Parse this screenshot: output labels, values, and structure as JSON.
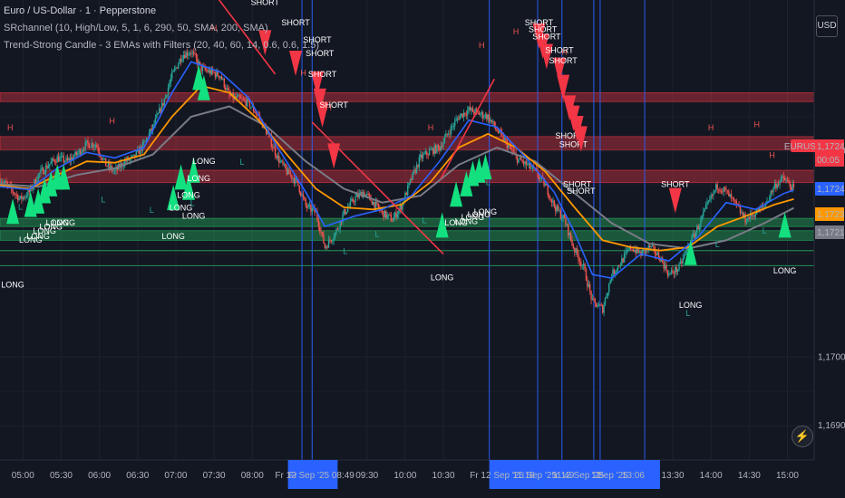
{
  "legend": {
    "title": "Euro / US-Dollar · 1 · Pepperstone",
    "indicator1": "SRchannel (10, High/Low, 5, 1, 6, 290, 50, SMA, 200, SMA)",
    "indicator2": "Trend-Strong Candle - 3 EMAs with Filters (20, 40, 60, 14, 0.6, 0.6, 1.5)"
  },
  "currency_badge": "USD",
  "bolt_icon": "lightning-icon",
  "colors": {
    "bg": "#131722",
    "up": "#26a69a",
    "down": "#ef5350",
    "long": "#13e07f",
    "short": "#f23645",
    "ema_fast": "#2962ff",
    "ema_mid": "#ff9800",
    "ema_slow": "#787b86",
    "vline": "#2962ff"
  },
  "chart_data": {
    "type": "candlestick",
    "symbol": "EURUSD",
    "x_ticks": [
      "05:00",
      "05:30",
      "06:00",
      "06:30",
      "07:00",
      "07:30",
      "08:00",
      "09:30",
      "10:00",
      "10:30",
      "13:30",
      "14:00",
      "14:30",
      "15:00"
    ],
    "x_range": [
      "04:42",
      "15:21"
    ],
    "y_ticks": [
      "1,17300",
      "1,17000",
      "1,16900"
    ],
    "y_tick_values": [
      1.173,
      1.17,
      1.169
    ],
    "ylim": [
      1.1685,
      1.1752
    ],
    "price_labels": [
      {
        "label": "EURUSD",
        "value": 1.17244,
        "color": "#f23645"
      },
      {
        "label": "1,17244",
        "value": 1.17244,
        "color": "#f23645"
      },
      {
        "label": "00:05",
        "value": 1.17244,
        "color": "#f23645",
        "sub": true
      },
      {
        "label": "1,17243",
        "value": 1.17243,
        "color": "#2962ff"
      },
      {
        "label": "1,17230",
        "value": 1.1723,
        "color": "#ff9800"
      },
      {
        "label": "1,17217",
        "value": 1.17217,
        "color": "#787b86"
      }
    ],
    "resistance_zones": [
      [
        1.17372,
        1.17385
      ],
      [
        1.17302,
        1.17321
      ],
      [
        1.17254,
        1.17272
      ]
    ],
    "support_zones": [
      [
        1.1719,
        1.17202
      ],
      [
        1.1717,
        1.17184
      ]
    ],
    "support_lines": [
      1.17155,
      1.17133
    ],
    "vertical_markers": [
      {
        "time": "08:39",
        "label": "Fr 12 Sep '25  08:49"
      },
      {
        "time": "08:47",
        "label": ""
      },
      {
        "time": "11:06",
        "label": "Fr 12 Sep '25  11:18"
      },
      {
        "time": "11:44",
        "label": "Sep '25  11:49"
      },
      {
        "time": "12:03",
        "label": "r 12 Sep '25  12"
      },
      {
        "time": "12:28",
        "label": "Sep '25  13:06"
      },
      {
        "time": "12:33",
        "label": ""
      },
      {
        "time": "13:08",
        "label": ""
      }
    ],
    "bottom_time_labels": [
      {
        "text": "Fr",
        "x_time": "08:32"
      },
      {
        "text": "Fr 12 Sep '25  08:49",
        "x_time": "08:49"
      },
      {
        "text": "Fr 12 Sep '25",
        "x_time": "11:12"
      },
      {
        "text": "11:18",
        "x_time": "11:33"
      },
      {
        "text": "Sep '25",
        "x_time": "11:47"
      },
      {
        "text": "11:49",
        "x_time": "12:04"
      },
      {
        "text": "r 12 Sep '25",
        "x_time": "12:17"
      },
      {
        "text": "12",
        "x_time": "12:30"
      },
      {
        "text": "Sep '25",
        "x_time": "12:43"
      },
      {
        "text": "13:06",
        "x_time": "12:59"
      }
    ],
    "series_close": [
      [
        "04:42",
        1.1726
      ],
      [
        "04:50",
        1.17245
      ],
      [
        "04:58",
        1.1723
      ],
      [
        "05:05",
        1.1724
      ],
      [
        "05:12",
        1.17265
      ],
      [
        "05:20",
        1.1728
      ],
      [
        "05:27",
        1.1729
      ],
      [
        "05:35",
        1.17285
      ],
      [
        "05:42",
        1.17295
      ],
      [
        "05:50",
        1.1731
      ],
      [
        "05:57",
        1.1731
      ],
      [
        "06:05",
        1.1728
      ],
      [
        "06:12",
        1.1727
      ],
      [
        "06:20",
        1.17285
      ],
      [
        "06:27",
        1.1729
      ],
      [
        "06:35",
        1.1731
      ],
      [
        "06:42",
        1.17335
      ],
      [
        "06:50",
        1.1737
      ],
      [
        "06:57",
        1.1741
      ],
      [
        "07:05",
        1.1744
      ],
      [
        "07:12",
        1.17445
      ],
      [
        "07:20",
        1.1742
      ],
      [
        "07:27",
        1.17415
      ],
      [
        "07:35",
        1.1741
      ],
      [
        "07:42",
        1.1738
      ],
      [
        "07:50",
        1.17375
      ],
      [
        "07:57",
        1.1737
      ],
      [
        "08:05",
        1.1735
      ],
      [
        "08:12",
        1.17325
      ],
      [
        "08:20",
        1.1729
      ],
      [
        "08:27",
        1.1727
      ],
      [
        "08:35",
        1.17255
      ],
      [
        "08:42",
        1.1722
      ],
      [
        "08:50",
        1.1721
      ],
      [
        "08:57",
        1.1716
      ],
      [
        "09:05",
        1.1718
      ],
      [
        "09:12",
        1.1721
      ],
      [
        "09:20",
        1.1723
      ],
      [
        "09:27",
        1.1724
      ],
      [
        "09:35",
        1.17225
      ],
      [
        "09:42",
        1.1721
      ],
      [
        "09:50",
        1.172
      ],
      [
        "09:57",
        1.1722
      ],
      [
        "10:05",
        1.1726
      ],
      [
        "10:12",
        1.1729
      ],
      [
        "10:20",
        1.173
      ],
      [
        "10:27",
        1.17305
      ],
      [
        "10:35",
        1.1733
      ],
      [
        "10:42",
        1.1735
      ],
      [
        "10:50",
        1.1736
      ],
      [
        "10:57",
        1.17355
      ],
      [
        "11:05",
        1.1735
      ],
      [
        "11:12",
        1.1733
      ],
      [
        "11:20",
        1.1731
      ],
      [
        "11:27",
        1.1729
      ],
      [
        "11:35",
        1.1728
      ],
      [
        "11:42",
        1.1727
      ],
      [
        "11:50",
        1.1725
      ],
      [
        "11:57",
        1.1722
      ],
      [
        "12:05",
        1.172
      ],
      [
        "12:12",
        1.1716
      ],
      [
        "12:20",
        1.1713
      ],
      [
        "12:27",
        1.1708
      ],
      [
        "12:35",
        1.1707
      ],
      [
        "12:42",
        1.1712
      ],
      [
        "12:50",
        1.1714
      ],
      [
        "12:57",
        1.1716
      ],
      [
        "13:05",
        1.1715
      ],
      [
        "13:12",
        1.1716
      ],
      [
        "13:20",
        1.17145
      ],
      [
        "13:27",
        1.1712
      ],
      [
        "13:35",
        1.1713
      ],
      [
        "13:42",
        1.1716
      ],
      [
        "13:50",
        1.1719
      ],
      [
        "13:57",
        1.1722
      ],
      [
        "14:05",
        1.1725
      ],
      [
        "14:12",
        1.1724
      ],
      [
        "14:20",
        1.1722
      ],
      [
        "14:27",
        1.172
      ],
      [
        "14:35",
        1.1721
      ],
      [
        "14:42",
        1.1722
      ],
      [
        "14:50",
        1.1725
      ],
      [
        "14:57",
        1.1726
      ],
      [
        "15:05",
        1.17244
      ]
    ],
    "ema_fast": [
      [
        "04:42",
        1.17248
      ],
      [
        "05:05",
        1.17244
      ],
      [
        "05:27",
        1.17275
      ],
      [
        "05:50",
        1.17298
      ],
      [
        "06:12",
        1.1729
      ],
      [
        "06:35",
        1.17305
      ],
      [
        "06:57",
        1.17385
      ],
      [
        "07:12",
        1.1743
      ],
      [
        "07:35",
        1.17415
      ],
      [
        "07:57",
        1.17378
      ],
      [
        "08:20",
        1.17305
      ],
      [
        "08:42",
        1.1724
      ],
      [
        "08:57",
        1.1719
      ],
      [
        "09:20",
        1.17205
      ],
      [
        "09:42",
        1.17215
      ],
      [
        "10:05",
        1.17235
      ],
      [
        "10:27",
        1.17285
      ],
      [
        "10:50",
        1.17345
      ],
      [
        "11:12",
        1.17335
      ],
      [
        "11:35",
        1.1729
      ],
      [
        "11:57",
        1.1724
      ],
      [
        "12:12",
        1.17185
      ],
      [
        "12:27",
        1.1712
      ],
      [
        "12:42",
        1.17115
      ],
      [
        "13:05",
        1.1715
      ],
      [
        "13:27",
        1.1714
      ],
      [
        "13:50",
        1.17175
      ],
      [
        "14:12",
        1.17225
      ],
      [
        "14:35",
        1.17215
      ],
      [
        "14:57",
        1.17238
      ],
      [
        "15:05",
        1.17243
      ]
    ],
    "ema_mid": [
      [
        "04:42",
        1.1725
      ],
      [
        "05:05",
        1.17245
      ],
      [
        "05:27",
        1.17265
      ],
      [
        "05:50",
        1.17285
      ],
      [
        "06:12",
        1.17283
      ],
      [
        "06:35",
        1.17295
      ],
      [
        "06:57",
        1.1735
      ],
      [
        "07:20",
        1.17395
      ],
      [
        "07:42",
        1.17385
      ],
      [
        "08:05",
        1.17345
      ],
      [
        "08:27",
        1.17295
      ],
      [
        "08:50",
        1.17245
      ],
      [
        "09:12",
        1.17218
      ],
      [
        "09:35",
        1.17215
      ],
      [
        "09:57",
        1.17222
      ],
      [
        "10:20",
        1.17255
      ],
      [
        "10:42",
        1.17305
      ],
      [
        "11:05",
        1.17325
      ],
      [
        "11:27",
        1.17305
      ],
      [
        "11:50",
        1.1727
      ],
      [
        "12:12",
        1.1722
      ],
      [
        "12:35",
        1.1717
      ],
      [
        "12:57",
        1.1716
      ],
      [
        "13:20",
        1.17155
      ],
      [
        "13:42",
        1.1716
      ],
      [
        "14:05",
        1.1719
      ],
      [
        "14:27",
        1.17205
      ],
      [
        "14:50",
        1.17222
      ],
      [
        "15:05",
        1.1723
      ]
    ],
    "ema_slow": [
      [
        "04:42",
        1.17252
      ],
      [
        "05:12",
        1.17248
      ],
      [
        "05:42",
        1.17265
      ],
      [
        "06:12",
        1.17275
      ],
      [
        "06:42",
        1.17295
      ],
      [
        "07:12",
        1.1735
      ],
      [
        "07:42",
        1.17365
      ],
      [
        "08:12",
        1.17335
      ],
      [
        "08:42",
        1.17285
      ],
      [
        "09:12",
        1.17245
      ],
      [
        "09:42",
        1.17225
      ],
      [
        "10:12",
        1.17235
      ],
      [
        "10:42",
        1.1728
      ],
      [
        "11:12",
        1.17305
      ],
      [
        "11:42",
        1.17285
      ],
      [
        "12:12",
        1.1724
      ],
      [
        "12:42",
        1.17195
      ],
      [
        "13:12",
        1.17165
      ],
      [
        "13:42",
        1.17158
      ],
      [
        "14:12",
        1.1717
      ],
      [
        "14:42",
        1.17195
      ],
      [
        "15:05",
        1.17217
      ]
    ],
    "trend_lines": [
      {
        "from": [
          "07:32",
          1.17525
        ],
        "to": [
          "08:18",
          1.17412
        ],
        "color": "#f23645"
      },
      {
        "from": [
          "08:47",
          1.17342
        ],
        "to": [
          "10:30",
          1.1715
        ],
        "color": "#f23645"
      },
      {
        "from": [
          "10:28",
          1.1726
        ],
        "to": [
          "11:10",
          1.17405
        ],
        "color": "#f23645"
      }
    ],
    "long_signals": [
      {
        "time": "04:52",
        "value": 1.17215,
        "label": "LONG",
        "label_value": 1.1712
      },
      {
        "time": "05:06",
        "value": 1.17225,
        "label": "LONG",
        "label_value": 1.17185
      },
      {
        "time": "05:12",
        "value": 1.1723,
        "label": "LONG",
        "label_value": 1.1719
      },
      {
        "time": "05:17",
        "value": 1.17245,
        "label": "LONG",
        "label_value": 1.17198
      },
      {
        "time": "05:22",
        "value": 1.17255,
        "label": "LONG",
        "label_value": 1.17204
      },
      {
        "time": "05:27",
        "value": 1.17265,
        "label": "LONG",
        "label_value": 1.1721
      },
      {
        "time": "05:32",
        "value": 1.17265,
        "label": "LONG",
        "label_value": 1.1721
      },
      {
        "time": "06:58",
        "value": 1.17235,
        "label": "LONG",
        "label_value": 1.1719
      },
      {
        "time": "07:04",
        "value": 1.17265,
        "label": "LONG",
        "label_value": 1.17232
      },
      {
        "time": "07:10",
        "value": 1.1725,
        "label": "LONG",
        "label_value": 1.1725
      },
      {
        "time": "07:14",
        "value": 1.17275,
        "label": "LONG",
        "label_value": 1.1722
      },
      {
        "time": "07:18",
        "value": 1.1741,
        "label": "LONG",
        "label_value": 1.17275
      },
      {
        "time": "07:22",
        "value": 1.17395,
        "label": "LONG",
        "label_value": 1.173
      },
      {
        "time": "10:29",
        "value": 1.17195,
        "label": "LONG",
        "label_value": 1.1713
      },
      {
        "time": "10:40",
        "value": 1.1724,
        "label": "LONG",
        "label_value": 1.1721
      },
      {
        "time": "10:48",
        "value": 1.17255,
        "label": "LONG",
        "label_value": 1.17212
      },
      {
        "time": "10:53",
        "value": 1.1727,
        "label": "LONG",
        "label_value": 1.17218
      },
      {
        "time": "10:58",
        "value": 1.17275,
        "label": "LONG",
        "label_value": 1.17222
      },
      {
        "time": "11:03",
        "value": 1.1728,
        "label": "LONG",
        "label_value": 1.17226
      },
      {
        "time": "13:44",
        "value": 1.17155,
        "label": "LONG",
        "label_value": 1.1709
      },
      {
        "time": "14:58",
        "value": 1.17195,
        "label": "LONG",
        "label_value": 1.1714
      }
    ],
    "short_signals": [
      {
        "time": "08:10",
        "value": 1.17455,
        "label": "SHORT",
        "label_value": 1.17505
      },
      {
        "time": "08:34",
        "value": 1.17425,
        "label": "SHORT",
        "label_value": 1.17475
      },
      {
        "time": "08:51",
        "value": 1.17395,
        "label": "SHORT",
        "label_value": 1.1745
      },
      {
        "time": "08:53",
        "value": 1.1737,
        "label": "SHORT",
        "label_value": 1.1743
      },
      {
        "time": "08:55",
        "value": 1.1735,
        "label": "SHORT",
        "label_value": 1.174
      },
      {
        "time": "09:04",
        "value": 1.1729,
        "label": "SHORT",
        "label_value": 1.17355
      },
      {
        "time": "11:45",
        "value": 1.17465,
        "label": "SHORT",
        "label_value": 1.17475
      },
      {
        "time": "11:48",
        "value": 1.1745,
        "label": "SHORT",
        "label_value": 1.17465
      },
      {
        "time": "11:51",
        "value": 1.17435,
        "label": "SHORT",
        "label_value": 1.17455
      },
      {
        "time": "12:01",
        "value": 1.17415,
        "label": "SHORT",
        "label_value": 1.17435
      },
      {
        "time": "12:04",
        "value": 1.1739,
        "label": "SHORT",
        "label_value": 1.1742
      },
      {
        "time": "12:09",
        "value": 1.1736,
        "label": "SHORT",
        "label_value": 1.1731
      },
      {
        "time": "12:12",
        "value": 1.17345,
        "label": "SHORT",
        "label_value": 1.17298
      },
      {
        "time": "12:15",
        "value": 1.1733,
        "label": "SHORT",
        "label_value": 1.1724
      },
      {
        "time": "12:18",
        "value": 1.17315,
        "label": "SHORT",
        "label_value": 1.1723
      },
      {
        "time": "13:32",
        "value": 1.17225,
        "label": "SHORT",
        "label_value": 1.1724
      }
    ],
    "high_markers": [
      {
        "time": "04:50",
        "value": 1.1733
      },
      {
        "time": "06:10",
        "value": 1.1734
      },
      {
        "time": "07:30",
        "value": 1.17475
      },
      {
        "time": "08:40",
        "value": 1.1741
      },
      {
        "time": "09:00",
        "value": 1.1736
      },
      {
        "time": "10:20",
        "value": 1.1733
      },
      {
        "time": "11:00",
        "value": 1.1745
      },
      {
        "time": "11:27",
        "value": 1.1747
      },
      {
        "time": "12:05",
        "value": 1.1744
      },
      {
        "time": "14:00",
        "value": 1.1733
      },
      {
        "time": "14:36",
        "value": 1.17335
      },
      {
        "time": "14:48",
        "value": 1.1729
      }
    ],
    "low_markers": [
      {
        "time": "04:58",
        "value": 1.17215
      },
      {
        "time": "06:03",
        "value": 1.17225
      },
      {
        "time": "06:41",
        "value": 1.1721
      },
      {
        "time": "07:13",
        "value": 1.1722
      },
      {
        "time": "07:52",
        "value": 1.1728
      },
      {
        "time": "09:13",
        "value": 1.1715
      },
      {
        "time": "09:38",
        "value": 1.17175
      },
      {
        "time": "10:15",
        "value": 1.17195
      },
      {
        "time": "11:05",
        "value": 1.1725
      },
      {
        "time": "13:42",
        "value": 1.1706
      },
      {
        "time": "14:05",
        "value": 1.1716
      },
      {
        "time": "14:42",
        "value": 1.1718
      }
    ]
  }
}
